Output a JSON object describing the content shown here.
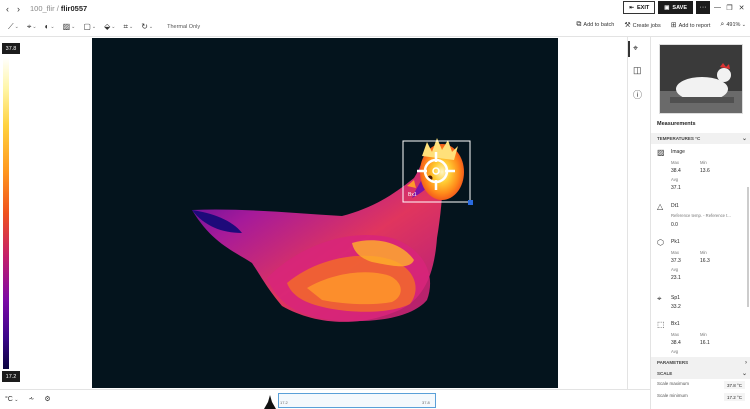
{
  "titlebar": {
    "back": "‹",
    "forward": "›",
    "folder": "100_flir",
    "separator": "/",
    "file": "flir0557",
    "exit_label": "EXIT",
    "save_label": "SAVE",
    "more_label": "···",
    "window": {
      "minimize": "—",
      "restore": "❐",
      "close": "✕"
    }
  },
  "toolbar": {
    "tools": [
      {
        "icon": "measure-tools-icon",
        "glyph": "⟋"
      },
      {
        "icon": "spot-icon",
        "glyph": "⌖"
      },
      {
        "icon": "palette-icon",
        "glyph": "◐"
      },
      {
        "icon": "image-icon",
        "glyph": "▨"
      },
      {
        "icon": "shape-icon",
        "glyph": "▢"
      },
      {
        "icon": "fill-icon",
        "glyph": "⬙"
      },
      {
        "icon": "crop-icon",
        "glyph": "⌗"
      },
      {
        "icon": "rotate-icon",
        "glyph": "↻"
      }
    ],
    "thermal_only": "Thermal Only",
    "add_to_batch": "Add to batch",
    "create_jobs": "Create jobs",
    "add_to_report": "Add to report",
    "zoom": "491%"
  },
  "scale": {
    "max": "37.8",
    "min": "17.2"
  },
  "overlay": {
    "box_label": "Bx1"
  },
  "bottombar": {
    "unit": "°C",
    "hist_left": "17.2",
    "hist_right": "37.8"
  },
  "panel": {
    "measurements_title": "Measurements",
    "temperatures_header": "TEMPERATURES °C",
    "items": [
      {
        "name": "Image",
        "max_label": "Max",
        "max": "38.4",
        "min_label": "Min",
        "min": "13.6",
        "avg_label": "Avg",
        "avg": "37.1"
      },
      {
        "name": "Dt1",
        "line": "Reference temp. - Reference t...",
        "value": "0.0"
      },
      {
        "name": "Pk1",
        "max_label": "Max",
        "max": "37.3",
        "min_label": "Min",
        "min": "16.3",
        "avg_label": "Avg",
        "avg": "23.1"
      },
      {
        "name": "Sp1",
        "value": "33.2"
      },
      {
        "name": "Bx1",
        "max_label": "Max",
        "max": "38.4",
        "min_label": "Min",
        "min": "16.1",
        "avg_label": "Avg"
      }
    ],
    "parameters_header": "PARAMETERS",
    "scale_header": "SCALE",
    "scale_max_label": "Scale maximum",
    "scale_max_value": "37.8 °C",
    "scale_min_label": "Scale minimum",
    "scale_min_value": "17.2 °C"
  }
}
